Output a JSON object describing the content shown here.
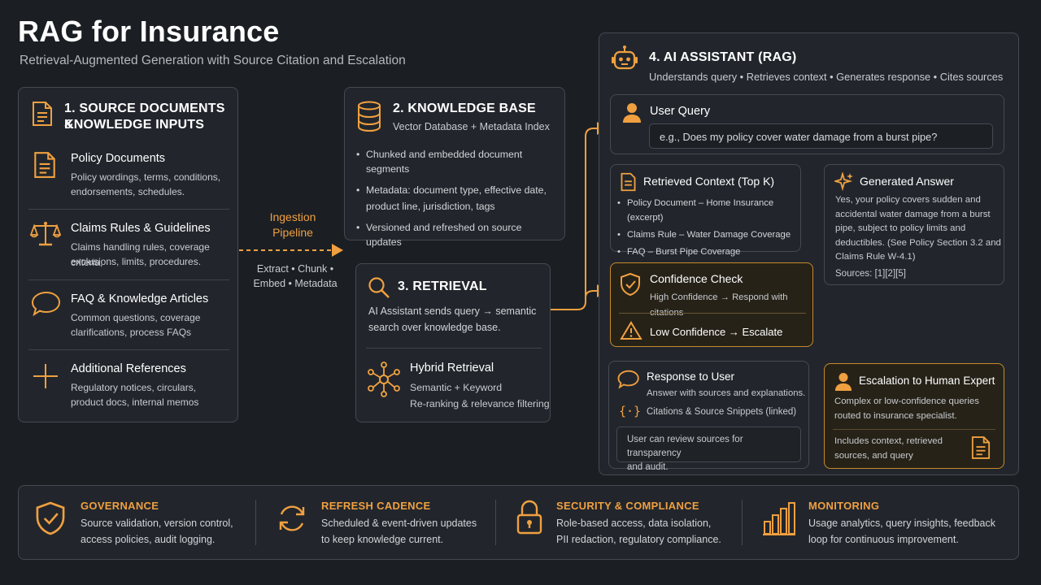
{
  "header": {
    "title": "RAG for Insurance",
    "subtitle": "Retrieval-Augmented Generation with Source Citation and Escalation"
  },
  "source_panel": {
    "title_line1": "1. SOURCE DOCUMENTS &",
    "title_line2": "KNOWLEDGE INPUTS",
    "items": [
      {
        "title": "Policy Documents",
        "desc1": "Policy wordings, terms, conditions,",
        "desc2": "endorsements, schedules.",
        "icon": "document-icon"
      },
      {
        "title": "Claims Rules & Guidelines",
        "desc1": "Claims handling rules, coverage criteria,",
        "desc2": "exclusions, limits, procedures.",
        "icon": "scales-icon"
      },
      {
        "title": "FAQ & Knowledge Articles",
        "desc1": "Common questions, coverage",
        "desc2": "clarifications, process FAQs",
        "icon": "chat-bubble-icon"
      },
      {
        "title": "Additional References",
        "desc1": "Regulatory notices, circulars,",
        "desc2": "product docs, internal memos",
        "icon": "plus-icon"
      }
    ]
  },
  "ingestion": {
    "label_line1": "Ingestion",
    "label_line2": "Pipeline",
    "steps_line1": "Extract • Chunk •",
    "steps_line2": "Embed • Metadata"
  },
  "knowledge_base": {
    "title": "2. KNOWLEDGE BASE",
    "subtitle": "Vector Database + Metadata Index",
    "bullets": [
      "Chunked and embedded document segments",
      "Metadata: document type, effective date,",
      "product line, jurisdiction, tags",
      "Versioned and refreshed on source updates"
    ]
  },
  "retrieval": {
    "title": "3. RETRIEVAL",
    "desc1": "AI Assistant sends query → semantic",
    "desc2": "search over knowledge base.",
    "hybrid_title": "Hybrid Retrieval",
    "hybrid_line1": "Semantic + Keyword",
    "hybrid_line2": "Re-ranking & relevance filtering"
  },
  "assistant": {
    "title": "4. AI ASSISTANT (RAG)",
    "subtitle": "Understands query • Retrieves context • Generates response • Cites sources",
    "user_query_title": "User Query",
    "user_query_example": "e.g., Does my policy cover water damage from a burst pipe?",
    "retrieved_title": "Retrieved Context (Top K)",
    "retrieved_items": [
      "Policy Document – Home Insurance (excerpt)",
      "Claims Rule – Water Damage Coverage",
      "FAQ – Burst Pipe Coverage"
    ],
    "answer_title": "Generated Answer",
    "answer_lines": [
      "Yes, your policy covers sudden and",
      "accidental water damage from a burst",
      "pipe, subject to policy limits and",
      "deductibles. (See Policy Section 3.2 and",
      "Claims Rule W-4.1)"
    ],
    "answer_sources": "Sources: [1][2][5]",
    "confidence_title": "Confidence Check",
    "confidence_high": "High Confidence → Respond with citations",
    "confidence_low": "Low Confidence → Escalate",
    "response_title": "Response to User",
    "response_desc": "Answer with sources and explanations.",
    "response_citations": "Citations & Source Snippets (linked)",
    "response_note1": "User can review sources for transparency",
    "response_note2": "and audit.",
    "escalation_title": "Escalation to Human Expert",
    "escalation_line1": "Complex or low-confidence queries",
    "escalation_line2": "routed to insurance specialist.",
    "escalation_note1": "Includes context, retrieved",
    "escalation_note2": "sources, and query"
  },
  "footer": [
    {
      "title": "GOVERNANCE",
      "line1": "Source validation, version control,",
      "line2": "access policies, audit logging.",
      "icon": "shield-check-icon"
    },
    {
      "title": "REFRESH CADENCE",
      "line1": "Scheduled & event-driven updates",
      "line2": "to keep knowledge current.",
      "icon": "refresh-icon"
    },
    {
      "title": "SECURITY & COMPLIANCE",
      "line1": "Role-based access, data isolation,",
      "line2": "PII redaction, regulatory compliance.",
      "icon": "lock-icon"
    },
    {
      "title": "MONITORING",
      "line1": "Usage analytics, query insights, feedback",
      "line2": "loop for continuous improvement.",
      "icon": "bar-chart-icon"
    }
  ],
  "colors": {
    "background": "#1b1f24",
    "accent": "#f0a040",
    "panel_border": "#454a51",
    "highlight_border": "#c88a2c"
  }
}
